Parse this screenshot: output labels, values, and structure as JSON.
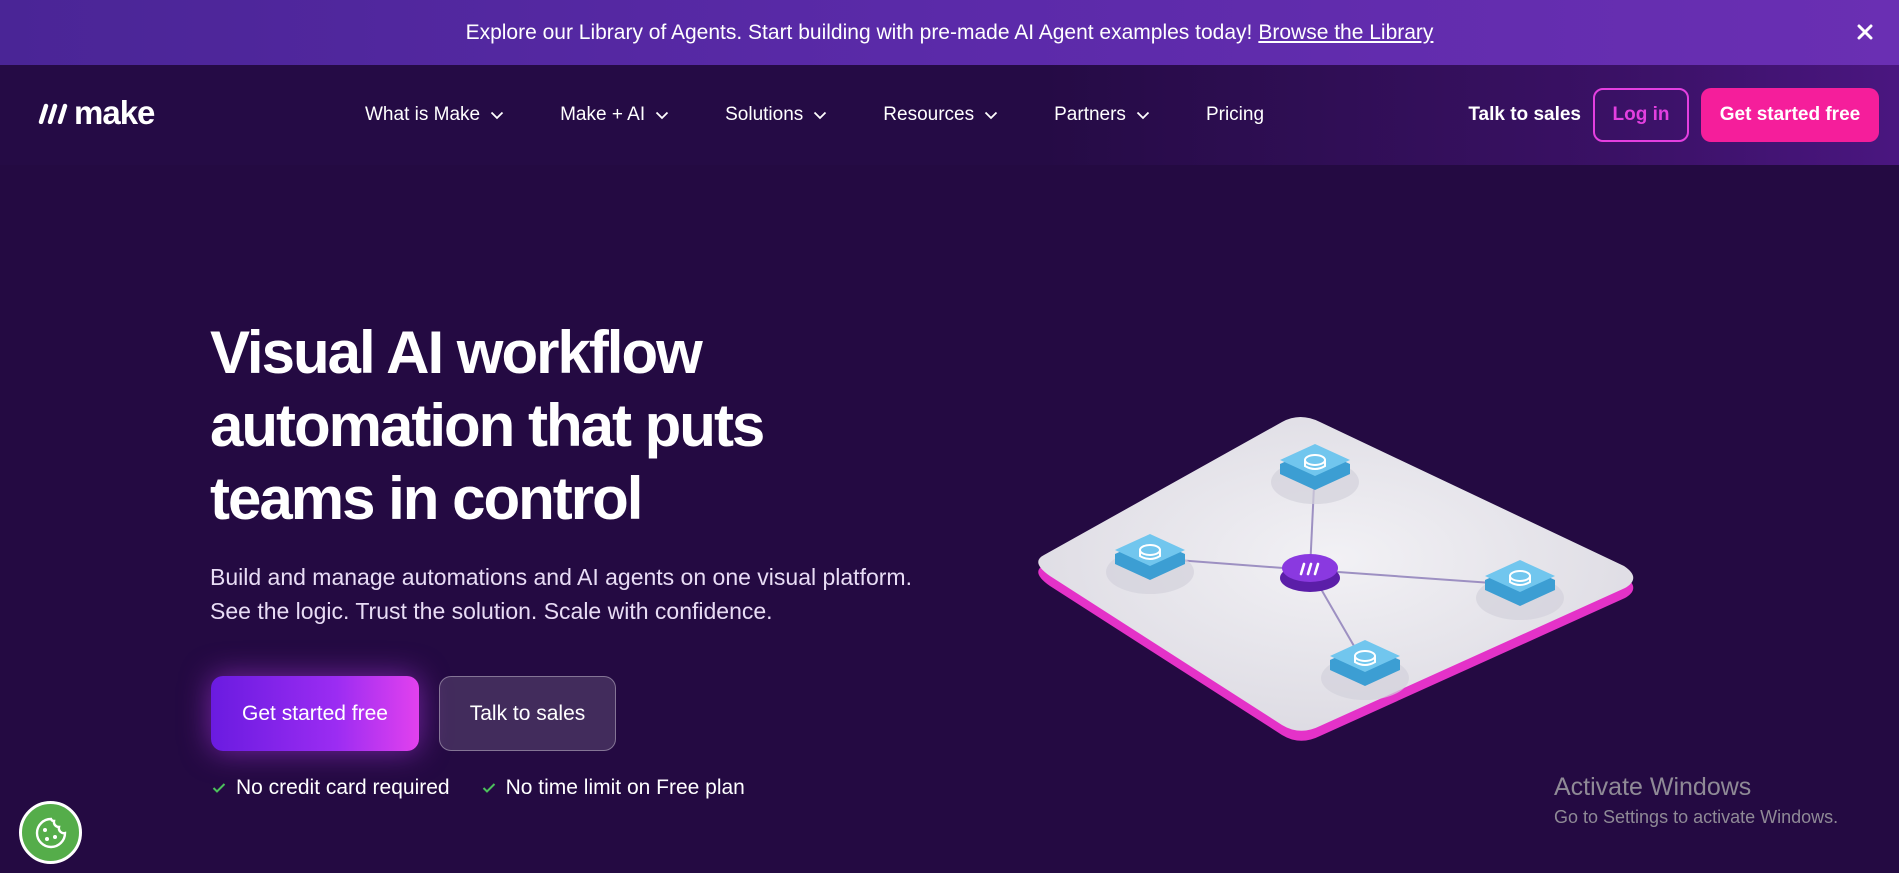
{
  "banner": {
    "text": "Explore our Library of Agents. Start building with pre-made AI Agent examples today!",
    "link": "Browse the Library",
    "close_icon": "close-icon"
  },
  "nav": {
    "logo_text": "make",
    "items": [
      {
        "label": "What is Make",
        "has_dropdown": true
      },
      {
        "label": "Make + AI",
        "has_dropdown": true
      },
      {
        "label": "Solutions",
        "has_dropdown": true
      },
      {
        "label": "Resources",
        "has_dropdown": true
      },
      {
        "label": "Partners",
        "has_dropdown": true
      },
      {
        "label": "Pricing",
        "has_dropdown": false
      }
    ],
    "talk_to_sales": "Talk to sales",
    "login": "Log in",
    "get_started": "Get started free"
  },
  "hero": {
    "title": "Visual AI workflow automation that puts teams in control",
    "subtitle": "Build and manage automations and AI agents on one visual platform. See the logic. Trust the solution. Scale with confidence.",
    "primary_cta": "Get started free",
    "secondary_cta": "Talk to sales",
    "checks": [
      "No credit card required",
      "No time limit on Free plan"
    ]
  },
  "illustration": {
    "description_icon": "workflow-platform-illustration",
    "hub_icon": "make-logo-icon",
    "node_icon": "database-icon"
  },
  "watermark": {
    "title": "Activate Windows",
    "subtitle": "Go to Settings to activate Windows."
  },
  "colors": {
    "banner": "#5b2aa9",
    "background": "#240a42",
    "accent_pink": "#f51e9b",
    "accent_magenta": "#e43fe0",
    "cookie_green": "#55ad4a"
  }
}
